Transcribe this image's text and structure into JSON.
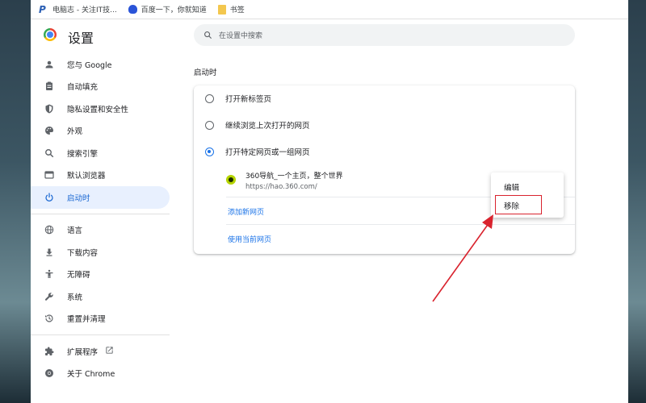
{
  "bookmarks": [
    {
      "label": "电脑志 - 关注IT技...",
      "icon": "p-site-icon"
    },
    {
      "label": "百度一下，你就知道",
      "icon": "baidu-paw-icon"
    },
    {
      "label": "书签",
      "icon": "folder-icon"
    }
  ],
  "header": {
    "title": "设置",
    "search_placeholder": "在设置中搜索"
  },
  "sidebar": {
    "items": [
      {
        "label": "您与 Google",
        "icon": "person-icon"
      },
      {
        "label": "自动填充",
        "icon": "clipboard-icon"
      },
      {
        "label": "隐私设置和安全性",
        "icon": "shield-icon"
      },
      {
        "label": "外观",
        "icon": "palette-icon"
      },
      {
        "label": "搜索引擎",
        "icon": "search-icon"
      },
      {
        "label": "默认浏览器",
        "icon": "browser-window-icon"
      },
      {
        "label": "启动时",
        "icon": "power-icon",
        "active": true
      }
    ],
    "items2": [
      {
        "label": "语言",
        "icon": "globe-icon"
      },
      {
        "label": "下载内容",
        "icon": "download-icon"
      },
      {
        "label": "无障碍",
        "icon": "accessibility-icon"
      },
      {
        "label": "系统",
        "icon": "wrench-icon"
      },
      {
        "label": "重置并清理",
        "icon": "history-icon"
      }
    ],
    "items3": [
      {
        "label": "扩展程序",
        "icon": "puzzle-icon"
      },
      {
        "label": "关于 Chrome",
        "icon": "chrome-icon"
      }
    ]
  },
  "startup": {
    "section_title": "启动时",
    "options": [
      {
        "label": "打开新标签页",
        "checked": false
      },
      {
        "label": "继续浏览上次打开的网页",
        "checked": false
      },
      {
        "label": "打开特定网页或一组网页",
        "checked": true
      }
    ],
    "page": {
      "name": "360导航_一个主页，整个世界",
      "url": "https://hao.360.com/"
    },
    "add_new_page": "添加新网页",
    "use_current_pages": "使用当前网页"
  },
  "context_menu": {
    "edit": "编辑",
    "remove": "移除"
  },
  "colors": {
    "accent": "#1a73e8",
    "active_bg": "#e8f0fe",
    "annotation": "#d9232e"
  }
}
